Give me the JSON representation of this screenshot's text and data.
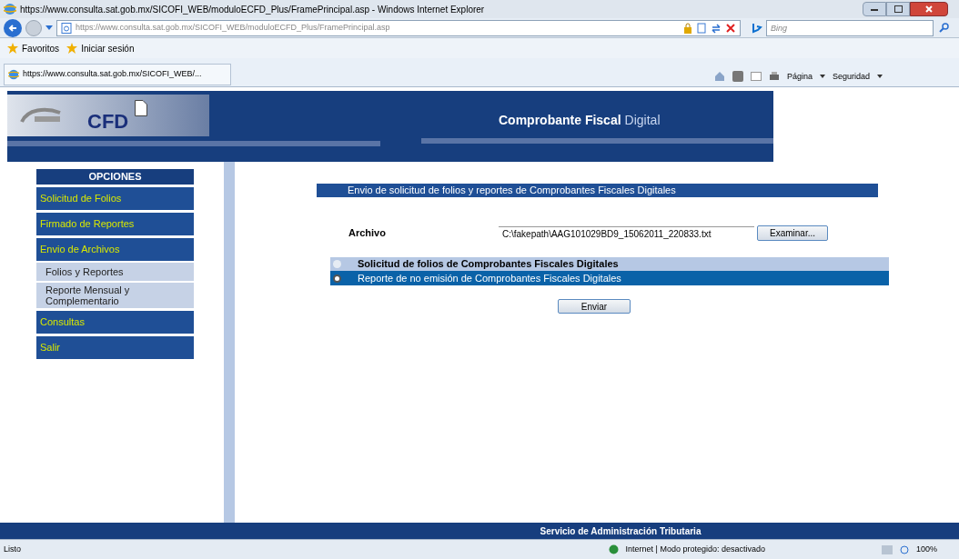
{
  "window": {
    "title": "https://www.consulta.sat.gob.mx/SICOFI_WEB/moduloECFD_Plus/FramePrincipal.asp - Windows Internet Explorer"
  },
  "address_bar": {
    "url": "https://www.consulta.sat.gob.mx/SICOFI_WEB/moduloECFD_Plus/FramePrincipal.asp"
  },
  "search": {
    "placeholder": "Bing"
  },
  "favorites_bar": [
    "Favoritos",
    "Iniciar sesión"
  ],
  "tab": {
    "title": "https://www.consulta.sat.gob.mx/SICOFI_WEB/..."
  },
  "command_bar": [
    "Página",
    "Seguridad"
  ],
  "banner": {
    "logo": "CFD",
    "title": "Comprobante Fiscal",
    "title_accent": "Digital"
  },
  "sidebar": {
    "title": "OPCIONES",
    "items": [
      {
        "label": "Solicitud de Folios",
        "kind": "section"
      },
      {
        "label": "Firmado de Reportes",
        "kind": "section"
      },
      {
        "label": "Envio de Archivos",
        "kind": "section"
      },
      {
        "label": "Folios y Reportes",
        "kind": "sub"
      },
      {
        "label": "Reporte Mensual y Complementario",
        "kind": "sub"
      },
      {
        "label": "Consultas",
        "kind": "section"
      },
      {
        "label": "Salir",
        "kind": "section"
      }
    ]
  },
  "form": {
    "heading": "Envio de solicitud de folios y reportes de Comprobantes Fiscales Digitales",
    "file_label": "Archivo",
    "file_value": "C:\\fakepath\\AAG101029BD9_15062011_220833.txt",
    "browse_button": "Examinar...",
    "options": [
      {
        "label": "Solicitud de folios de Comprobantes Fiscales Digitales",
        "selected": false
      },
      {
        "label": "Reporte de no emisión de Comprobantes Fiscales Digitales",
        "selected": true
      }
    ],
    "submit_button": "Enviar"
  },
  "footer": "Servicio de Administración Tributaria",
  "status_bar": {
    "status": "Listo",
    "zone": "Internet | Modo protegido: desactivado",
    "zoom": "100%"
  }
}
